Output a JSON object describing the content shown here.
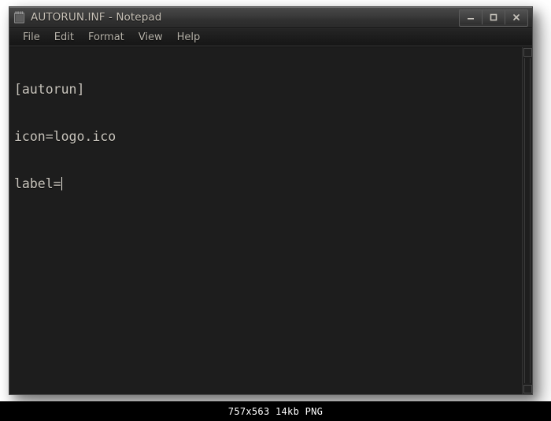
{
  "window": {
    "title": "AUTORUN.INF - Notepad",
    "icon": "notepad-icon",
    "controls": {
      "minimize_label": "—",
      "maximize_label": "□",
      "close_label": "✕"
    }
  },
  "menubar": {
    "items": [
      {
        "label": "File"
      },
      {
        "label": "Edit"
      },
      {
        "label": "Format"
      },
      {
        "label": "View"
      },
      {
        "label": "Help"
      }
    ]
  },
  "editor": {
    "lines": [
      "[autorun]",
      "icon=logo.ico",
      "label="
    ],
    "caret_after_line": 3,
    "text_color": "#c9c5bd",
    "background_color": "#1d1d1d"
  },
  "scrollbar": {
    "up_arrow": "scroll-up-arrow",
    "down_arrow": "scroll-down-arrow"
  },
  "footer": {
    "info": "757x563 14kb PNG"
  },
  "colors": {
    "page_background": "#ffffff",
    "titlebar": "#3a3a3a",
    "menubar": "#1c1c1c",
    "footer_background": "#000000"
  }
}
